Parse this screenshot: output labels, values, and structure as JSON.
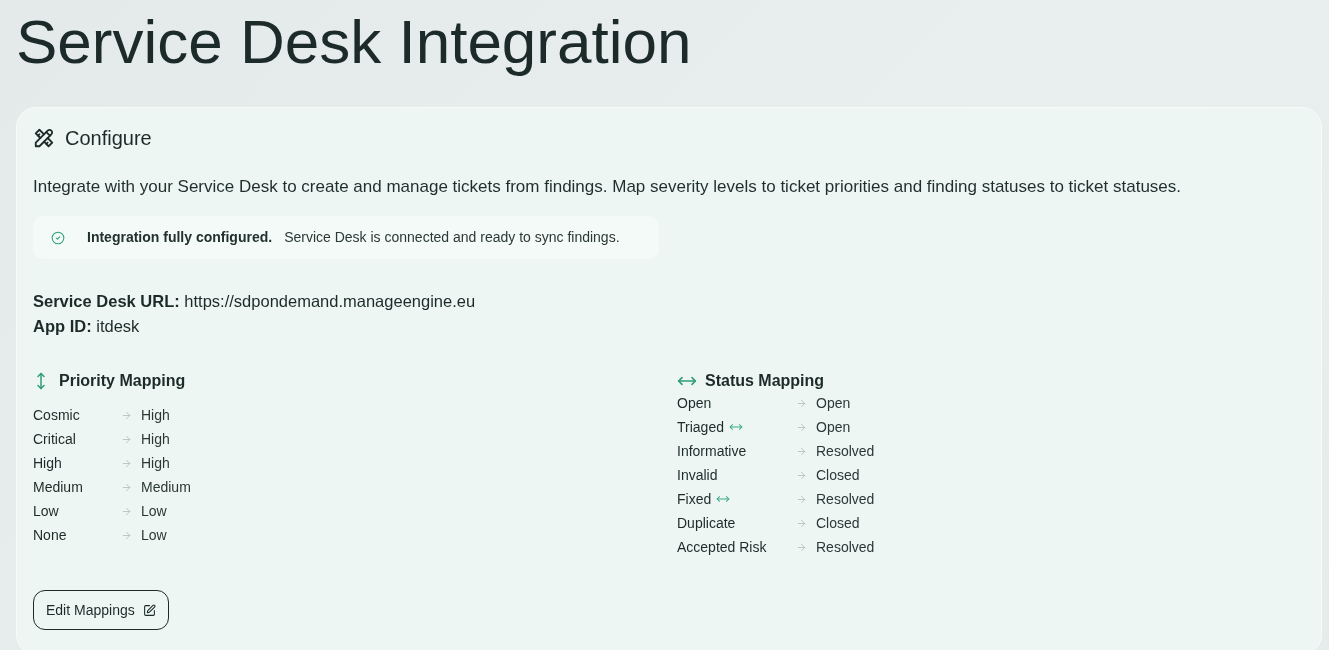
{
  "page": {
    "title": "Service Desk Integration"
  },
  "card": {
    "title": "Configure",
    "description": "Integrate with your Service Desk to create and manage tickets from findings. Map severity levels to ticket priorities and finding statuses to ticket statuses.",
    "status_callout": {
      "title": "Integration fully configured.",
      "message": "Service Desk is connected and ready to sync findings."
    },
    "details": [
      "**Service Desk URL:** https://sdpondemand.manageengine.eu",
      "**App ID:** itdesk"
    ],
    "priority_mapping": {
      "title": "Priority Mapping",
      "rows": [
        {
          "from": "Cosmic",
          "to": "High"
        },
        {
          "from": "Critical",
          "to": "High"
        },
        {
          "from": "High",
          "to": "High"
        },
        {
          "from": "Medium",
          "to": "Medium"
        },
        {
          "from": "Low",
          "to": "Low"
        },
        {
          "from": "None",
          "to": "Low"
        }
      ]
    },
    "status_mapping": {
      "title": "Status Mapping",
      "rows": [
        {
          "from": "Open",
          "to": "Open",
          "two_way": false
        },
        {
          "from": "Triaged",
          "to": "Open",
          "two_way": true
        },
        {
          "from": "Informative",
          "to": "Resolved",
          "two_way": false
        },
        {
          "from": "Invalid",
          "to": "Closed",
          "two_way": false
        },
        {
          "from": "Fixed",
          "to": "Resolved",
          "two_way": true
        },
        {
          "from": "Duplicate",
          "to": "Closed",
          "two_way": false
        },
        {
          "from": "Accepted Risk",
          "to": "Resolved",
          "two_way": false
        }
      ]
    },
    "edit_button": {
      "label": "Edit Mappings"
    }
  }
}
